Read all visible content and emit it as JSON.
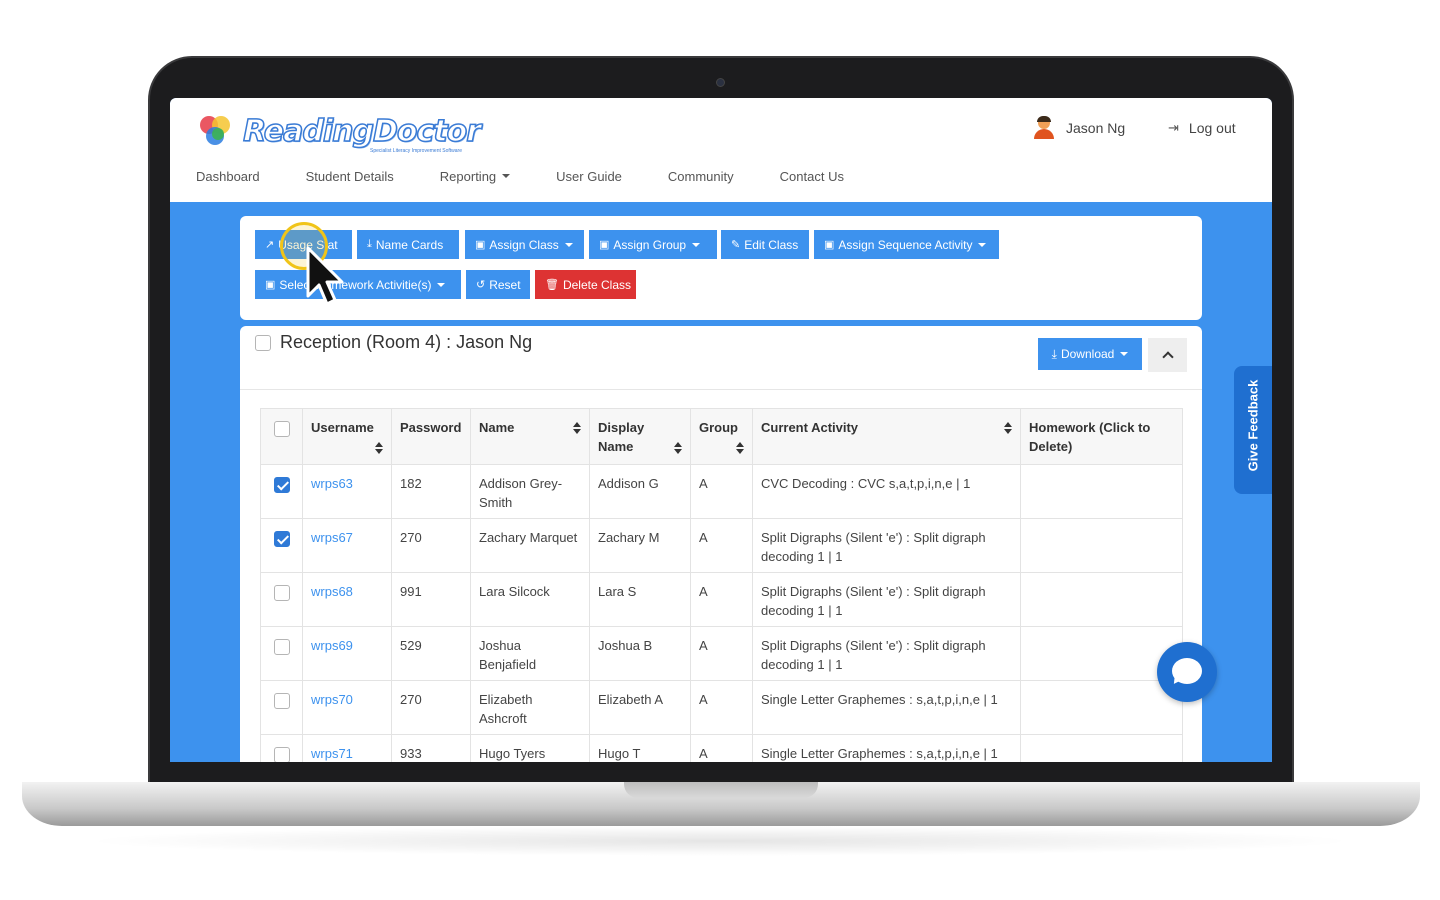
{
  "brand": {
    "name": "ReadingDoctor",
    "tagline": "Specialist Literacy Improvement Software"
  },
  "user": {
    "name": "Jason Ng",
    "logout_label": "Log out"
  },
  "nav": {
    "items": [
      {
        "label": "Dashboard"
      },
      {
        "label": "Student Details"
      },
      {
        "label": "Reporting"
      },
      {
        "label": "User Guide"
      },
      {
        "label": "Community"
      },
      {
        "label": "Contact Us"
      }
    ]
  },
  "toolbar": {
    "usage_stat": "Usage Stat",
    "name_cards": "Name Cards",
    "assign_class": "Assign Class",
    "assign_group": "Assign Group",
    "edit_class": "Edit Class",
    "assign_sequence": "Assign Sequence Activity",
    "select_homework": "Select Homework Activitie(s)",
    "reset": "Reset",
    "delete_class": "Delete Class"
  },
  "class_panel": {
    "title": "Reception (Room 4) : Jason Ng",
    "download_label": "Download"
  },
  "table": {
    "headers": {
      "username": "Username",
      "password": "Password",
      "name": "Name",
      "display_name": "Display Name",
      "group": "Group",
      "current_activity": "Current Activity",
      "homework": "Homework (Click to Delete)"
    },
    "rows": [
      {
        "checked": true,
        "username": "wrps63",
        "password": "182",
        "name": "Addison Grey-Smith",
        "display_name": "Addison G",
        "group": "A",
        "current_activity": "CVC Decoding : CVC s,a,t,p,i,n,e | 1",
        "homework": ""
      },
      {
        "checked": true,
        "username": "wrps67",
        "password": "270",
        "name": "Zachary Marquet",
        "display_name": "Zachary M",
        "group": "A",
        "current_activity": "Split Digraphs (Silent 'e') : Split digraph decoding 1 | 1",
        "homework": ""
      },
      {
        "checked": false,
        "username": "wrps68",
        "password": "991",
        "name": "Lara Silcock",
        "display_name": "Lara S",
        "group": "A",
        "current_activity": "Split Digraphs (Silent 'e') : Split digraph decoding 1 | 1",
        "homework": ""
      },
      {
        "checked": false,
        "username": "wrps69",
        "password": "529",
        "name": "Joshua Benjafield",
        "display_name": "Joshua B",
        "group": "A",
        "current_activity": "Split Digraphs (Silent 'e') : Split digraph decoding 1 | 1",
        "homework": ""
      },
      {
        "checked": false,
        "username": "wrps70",
        "password": "270",
        "name": "Elizabeth Ashcroft",
        "display_name": "Elizabeth A",
        "group": "A",
        "current_activity": "Single Letter Graphemes : s,a,t,p,i,n,e | 1",
        "homework": ""
      },
      {
        "checked": false,
        "username": "wrps71",
        "password": "933",
        "name": "Hugo Tyers",
        "display_name": "Hugo T",
        "group": "A",
        "current_activity": "Single Letter Graphemes : s,a,t,p,i,n,e | 1",
        "homework": ""
      }
    ]
  },
  "feedback_label": "Give Feedback",
  "colors": {
    "primary": "#3d92ee",
    "danger": "#dd3333",
    "feedback": "#1f6fd0",
    "highlight": "#f0c419"
  },
  "icons": {
    "usage_stat": "line-chart-icon",
    "name_cards": "download-icon",
    "assign_class": "briefcase-icon",
    "assign_group": "briefcase-icon",
    "edit_class": "edit-icon",
    "assign_sequence": "briefcase-icon",
    "select_homework": "briefcase-icon",
    "reset": "undo-icon",
    "delete_class": "trash-icon",
    "logout": "sign-out-icon",
    "chat": "chat-bubble-icon"
  }
}
